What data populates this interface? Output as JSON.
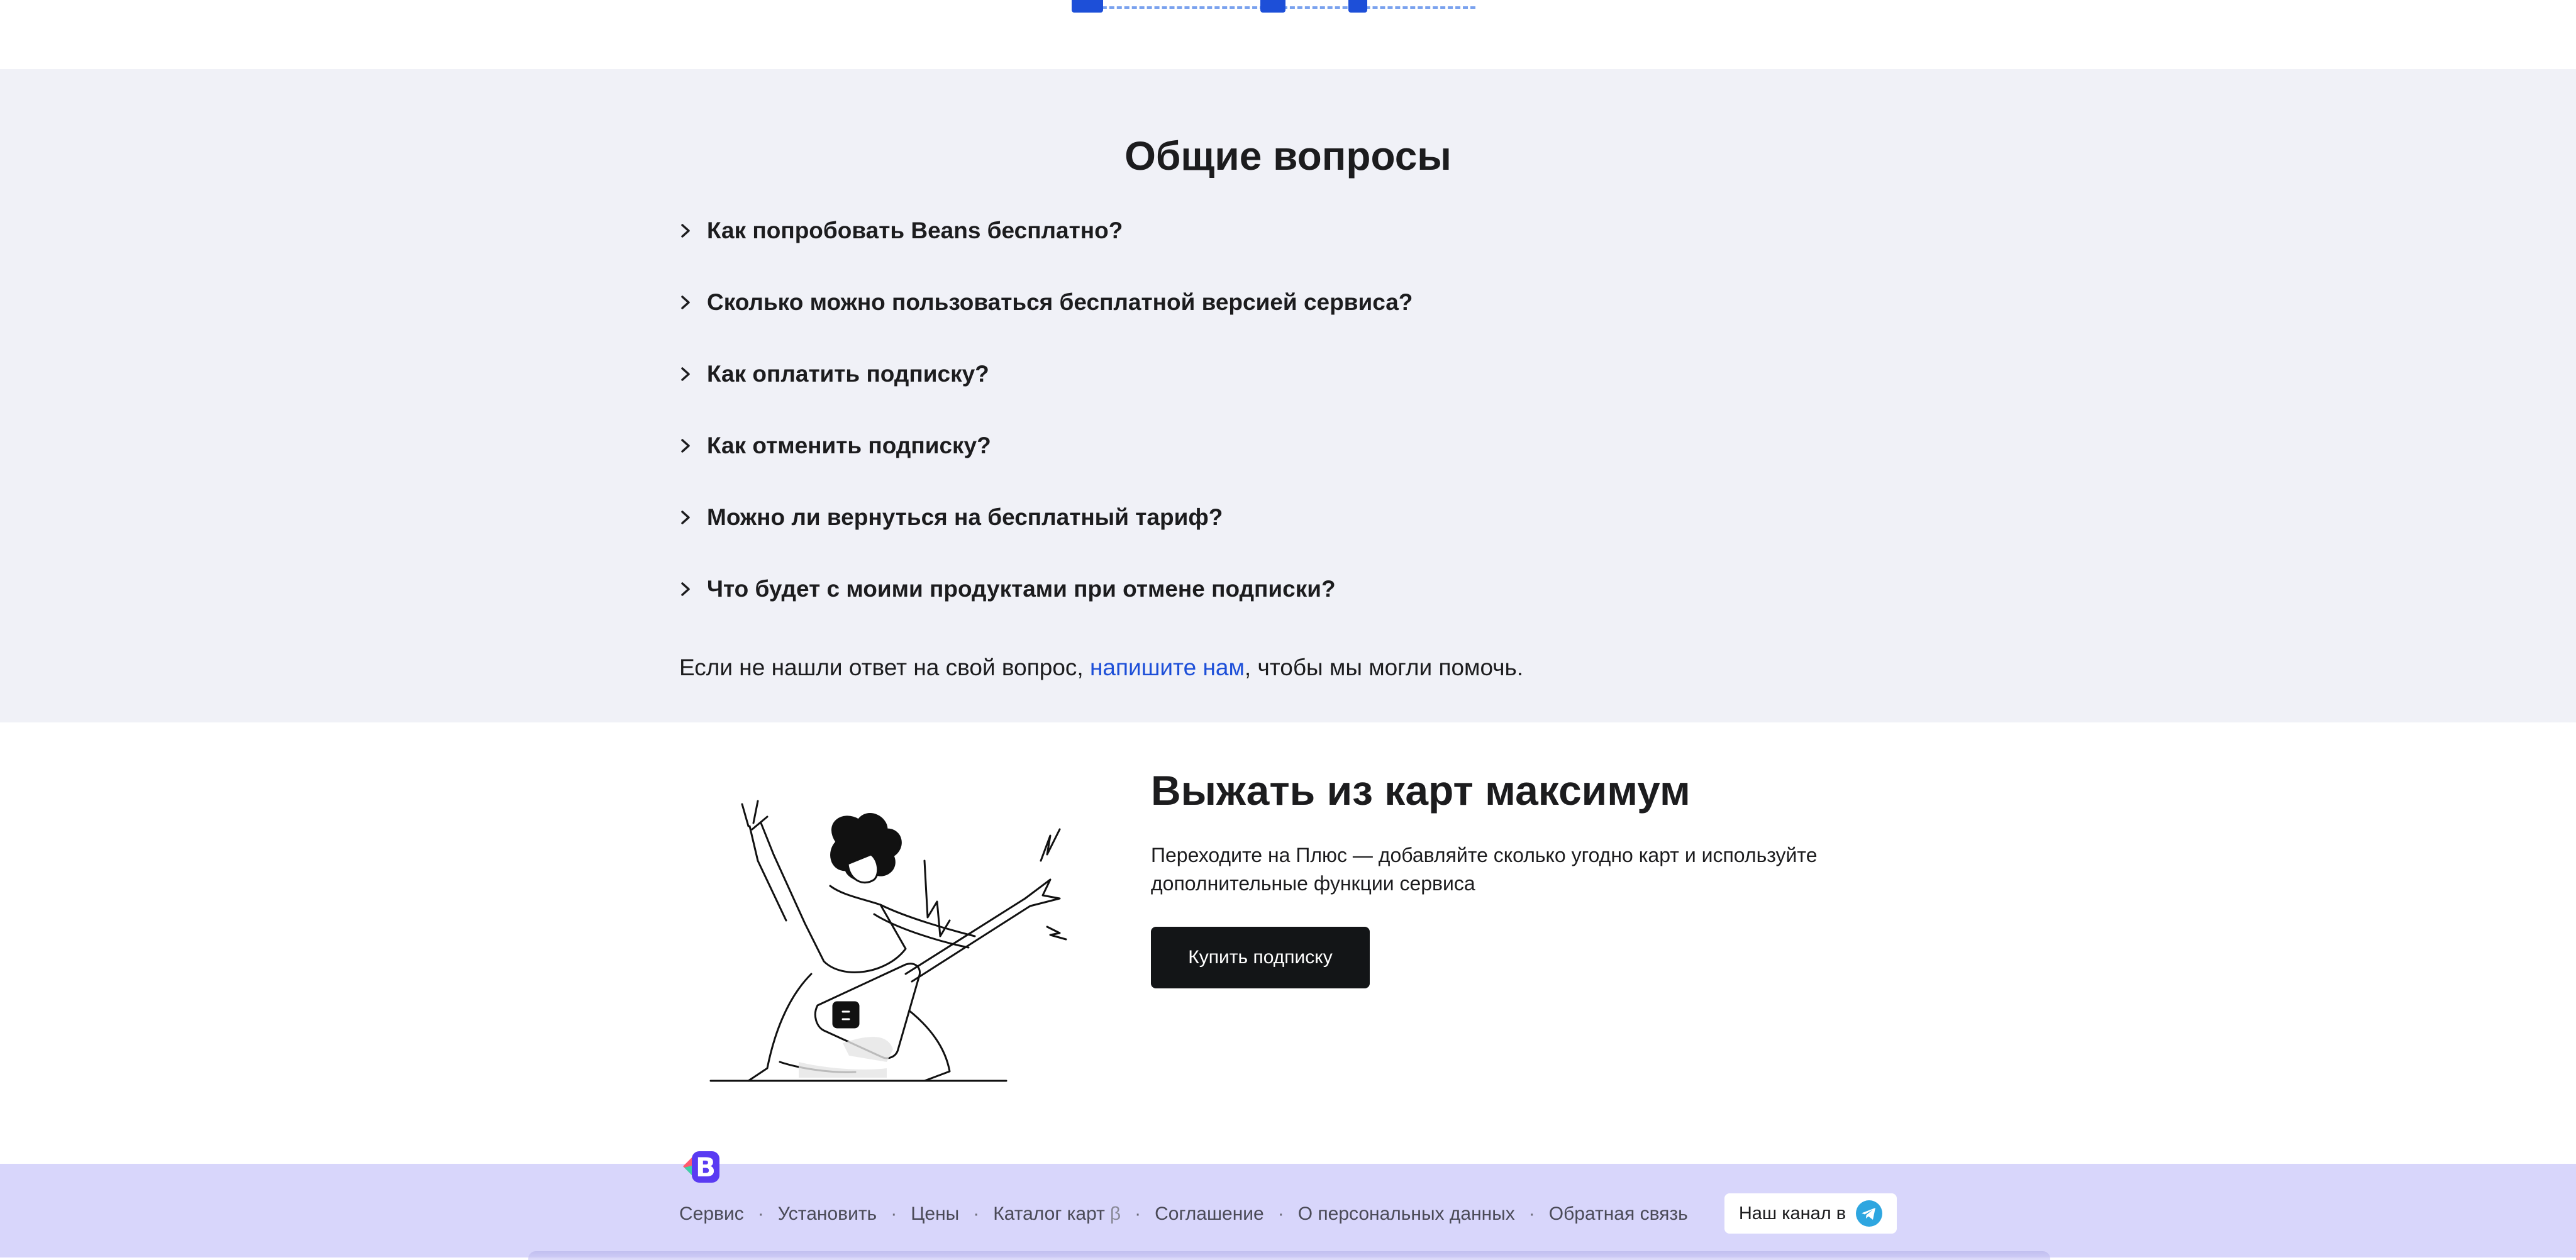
{
  "faq": {
    "title": "Общие вопросы",
    "items": [
      {
        "question": "Как попробовать Beans бесплатно?"
      },
      {
        "question": "Сколько можно пользоваться бесплатной версией сервиса?"
      },
      {
        "question": "Как оплатить подписку?"
      },
      {
        "question": "Как отменить подписку?"
      },
      {
        "question": "Можно ли вернуться на бесплатный тариф?"
      },
      {
        "question": "Что будет с моими продуктами при отмене подписки?"
      }
    ],
    "note_before": "Если не нашли ответ на свой вопрос, ",
    "note_link": "напишите нам",
    "note_after": ", чтобы мы могли помочь."
  },
  "promo": {
    "title": "Выжать из карт максимум",
    "text": "Переходите на Плюс — добавляйте сколько угодно карт и используйте дополнительные функции сервиса",
    "button_label": "Купить подписку"
  },
  "footer": {
    "logo_letter": "B",
    "links": [
      {
        "label": "Сервис"
      },
      {
        "label": "Установить"
      },
      {
        "label": "Цены"
      },
      {
        "label": "Каталог карт",
        "badge": "β"
      },
      {
        "label": "Соглашение"
      },
      {
        "label": "О персональных данных"
      },
      {
        "label": "Обратная связь"
      }
    ],
    "channel_label": "Наш канал в"
  },
  "colors": {
    "faq_background": "#f0f1f7",
    "footer_background": "#d8d6fb",
    "link": "#1d4fd8",
    "button": "#131517",
    "telegram": "#2ea6e0"
  }
}
